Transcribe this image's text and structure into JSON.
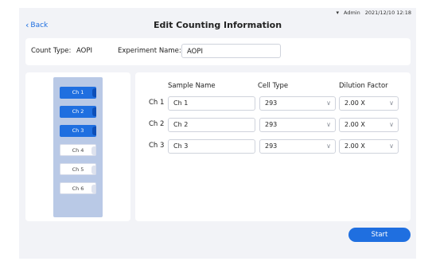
{
  "status": {
    "user": "Admin",
    "datetime": "2021/12/10 12:18"
  },
  "header": {
    "back_label": "Back",
    "title": "Edit Counting Information"
  },
  "info": {
    "count_type_label": "Count Type:",
    "count_type_value": "AOPI",
    "experiment_label": "Experiment Name:",
    "experiment_value": "AOPI"
  },
  "rack": {
    "slots": [
      {
        "label": "Ch 1",
        "selected": true
      },
      {
        "label": "Ch 2",
        "selected": true
      },
      {
        "label": "Ch 3",
        "selected": true
      },
      {
        "label": "Ch 4",
        "selected": false
      },
      {
        "label": "Ch 5",
        "selected": false
      },
      {
        "label": "Ch 6",
        "selected": false
      }
    ]
  },
  "table": {
    "headers": {
      "sample": "Sample Name",
      "cell": "Cell Type",
      "dilution": "Dilution Factor"
    },
    "rows": [
      {
        "label": "Ch 1",
        "sample": "Ch 1",
        "cell": "293",
        "dilution": "2.00 X"
      },
      {
        "label": "Ch 2",
        "sample": "Ch 2",
        "cell": "293",
        "dilution": "2.00 X"
      },
      {
        "label": "Ch 3",
        "sample": "Ch 3",
        "cell": "293",
        "dilution": "2.00 X"
      }
    ]
  },
  "actions": {
    "start_label": "Start"
  },
  "colors": {
    "accent": "#1f6fe0",
    "rack": "#b9c9e6",
    "background": "#f2f3f7"
  },
  "icons": {
    "back": "chevron-left-icon",
    "wifi": "wifi-icon",
    "dropdown": "chevron-down-icon"
  }
}
